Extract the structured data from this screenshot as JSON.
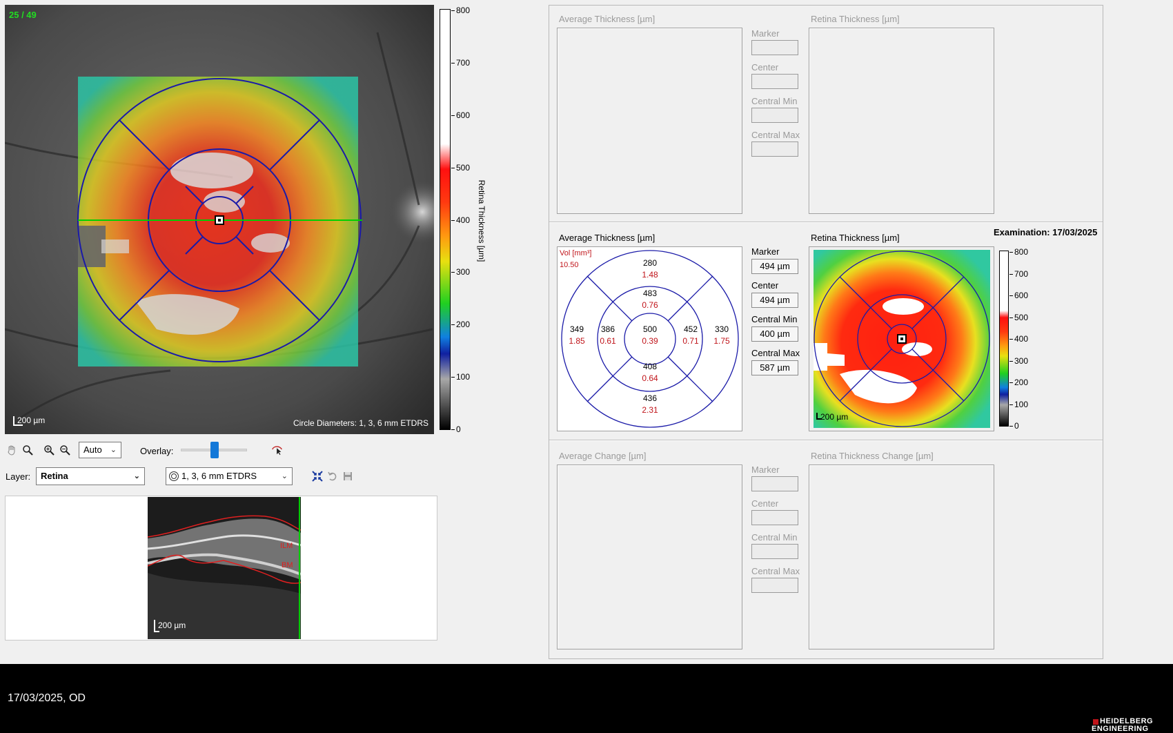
{
  "fundus": {
    "slice_counter": "25 / 49",
    "scale_label": "200 µm",
    "circle_label": "Circle Diameters: 1, 3, 6 mm ETDRS",
    "colorbar_title": "Retina Thickness [µm]",
    "colorbar_ticks": [
      "800",
      "700",
      "600",
      "500",
      "400",
      "300",
      "200",
      "100",
      "0"
    ]
  },
  "toolbar": {
    "zoom_value": "Auto",
    "overlay_label": "Overlay:",
    "overlay_level": 0.5,
    "layer_label": "Layer:",
    "layer_value": "Retina",
    "grid_value": "1, 3, 6 mm ETDRS"
  },
  "bscan": {
    "ilm_label": "ILM",
    "bm_label": "BM",
    "scale_label": "200 µm"
  },
  "top_panel": {
    "avg_title": "Average Thickness [µm]",
    "retina_title": "Retina Thickness [µm]",
    "marker_label": "Marker",
    "center_label": "Center",
    "cmin_label": "Central Min",
    "cmax_label": "Central Max"
  },
  "mid_panel": {
    "examination": "Examination: 17/03/2025",
    "avg_title": "Average Thickness [µm]",
    "retina_title": "Retina Thickness [µm]",
    "vol_label": "Vol [mm³]",
    "vol_value": "10.50",
    "marker_label": "Marker",
    "marker_value": "494 µm",
    "center_label": "Center",
    "center_value": "494 µm",
    "cmin_label": "Central Min",
    "cmin_value": "400 µm",
    "cmax_label": "Central Max",
    "cmax_value": "587 µm",
    "map_scale": "200 µm",
    "colorbar_ticks": [
      "800",
      "700",
      "600",
      "500",
      "400",
      "300",
      "200",
      "100",
      "0"
    ],
    "etdrs": {
      "superior_outer": {
        "t": "280",
        "v": "1.48"
      },
      "superior_inner": {
        "t": "483",
        "v": "0.76"
      },
      "temporal_outer": {
        "t": "349",
        "v": "1.85"
      },
      "temporal_inner": {
        "t": "386",
        "v": "0.61"
      },
      "center": {
        "t": "500",
        "v": "0.39"
      },
      "nasal_inner": {
        "t": "452",
        "v": "0.71"
      },
      "nasal_outer": {
        "t": "330",
        "v": "1.75"
      },
      "inferior_inner": {
        "t": "408",
        "v": "0.64"
      },
      "inferior_outer": {
        "t": "436",
        "v": "2.31"
      }
    }
  },
  "bottom_panel": {
    "avg_title": "Average Change [µm]",
    "retina_title": "Retina Thickness Change [µm]",
    "marker_label": "Marker",
    "center_label": "Center",
    "cmin_label": "Central Min",
    "cmax_label": "Central Max"
  },
  "footer": {
    "date_eye": "17/03/2025, OD",
    "brand_line1": "HEIDELBERG",
    "brand_line2": "ENGINEERING"
  },
  "colors": {
    "grid_blue": "#1a1aa8",
    "scan_line": "#00d000",
    "volume_red": "#c0141a",
    "counter_green": "#22dd22"
  }
}
